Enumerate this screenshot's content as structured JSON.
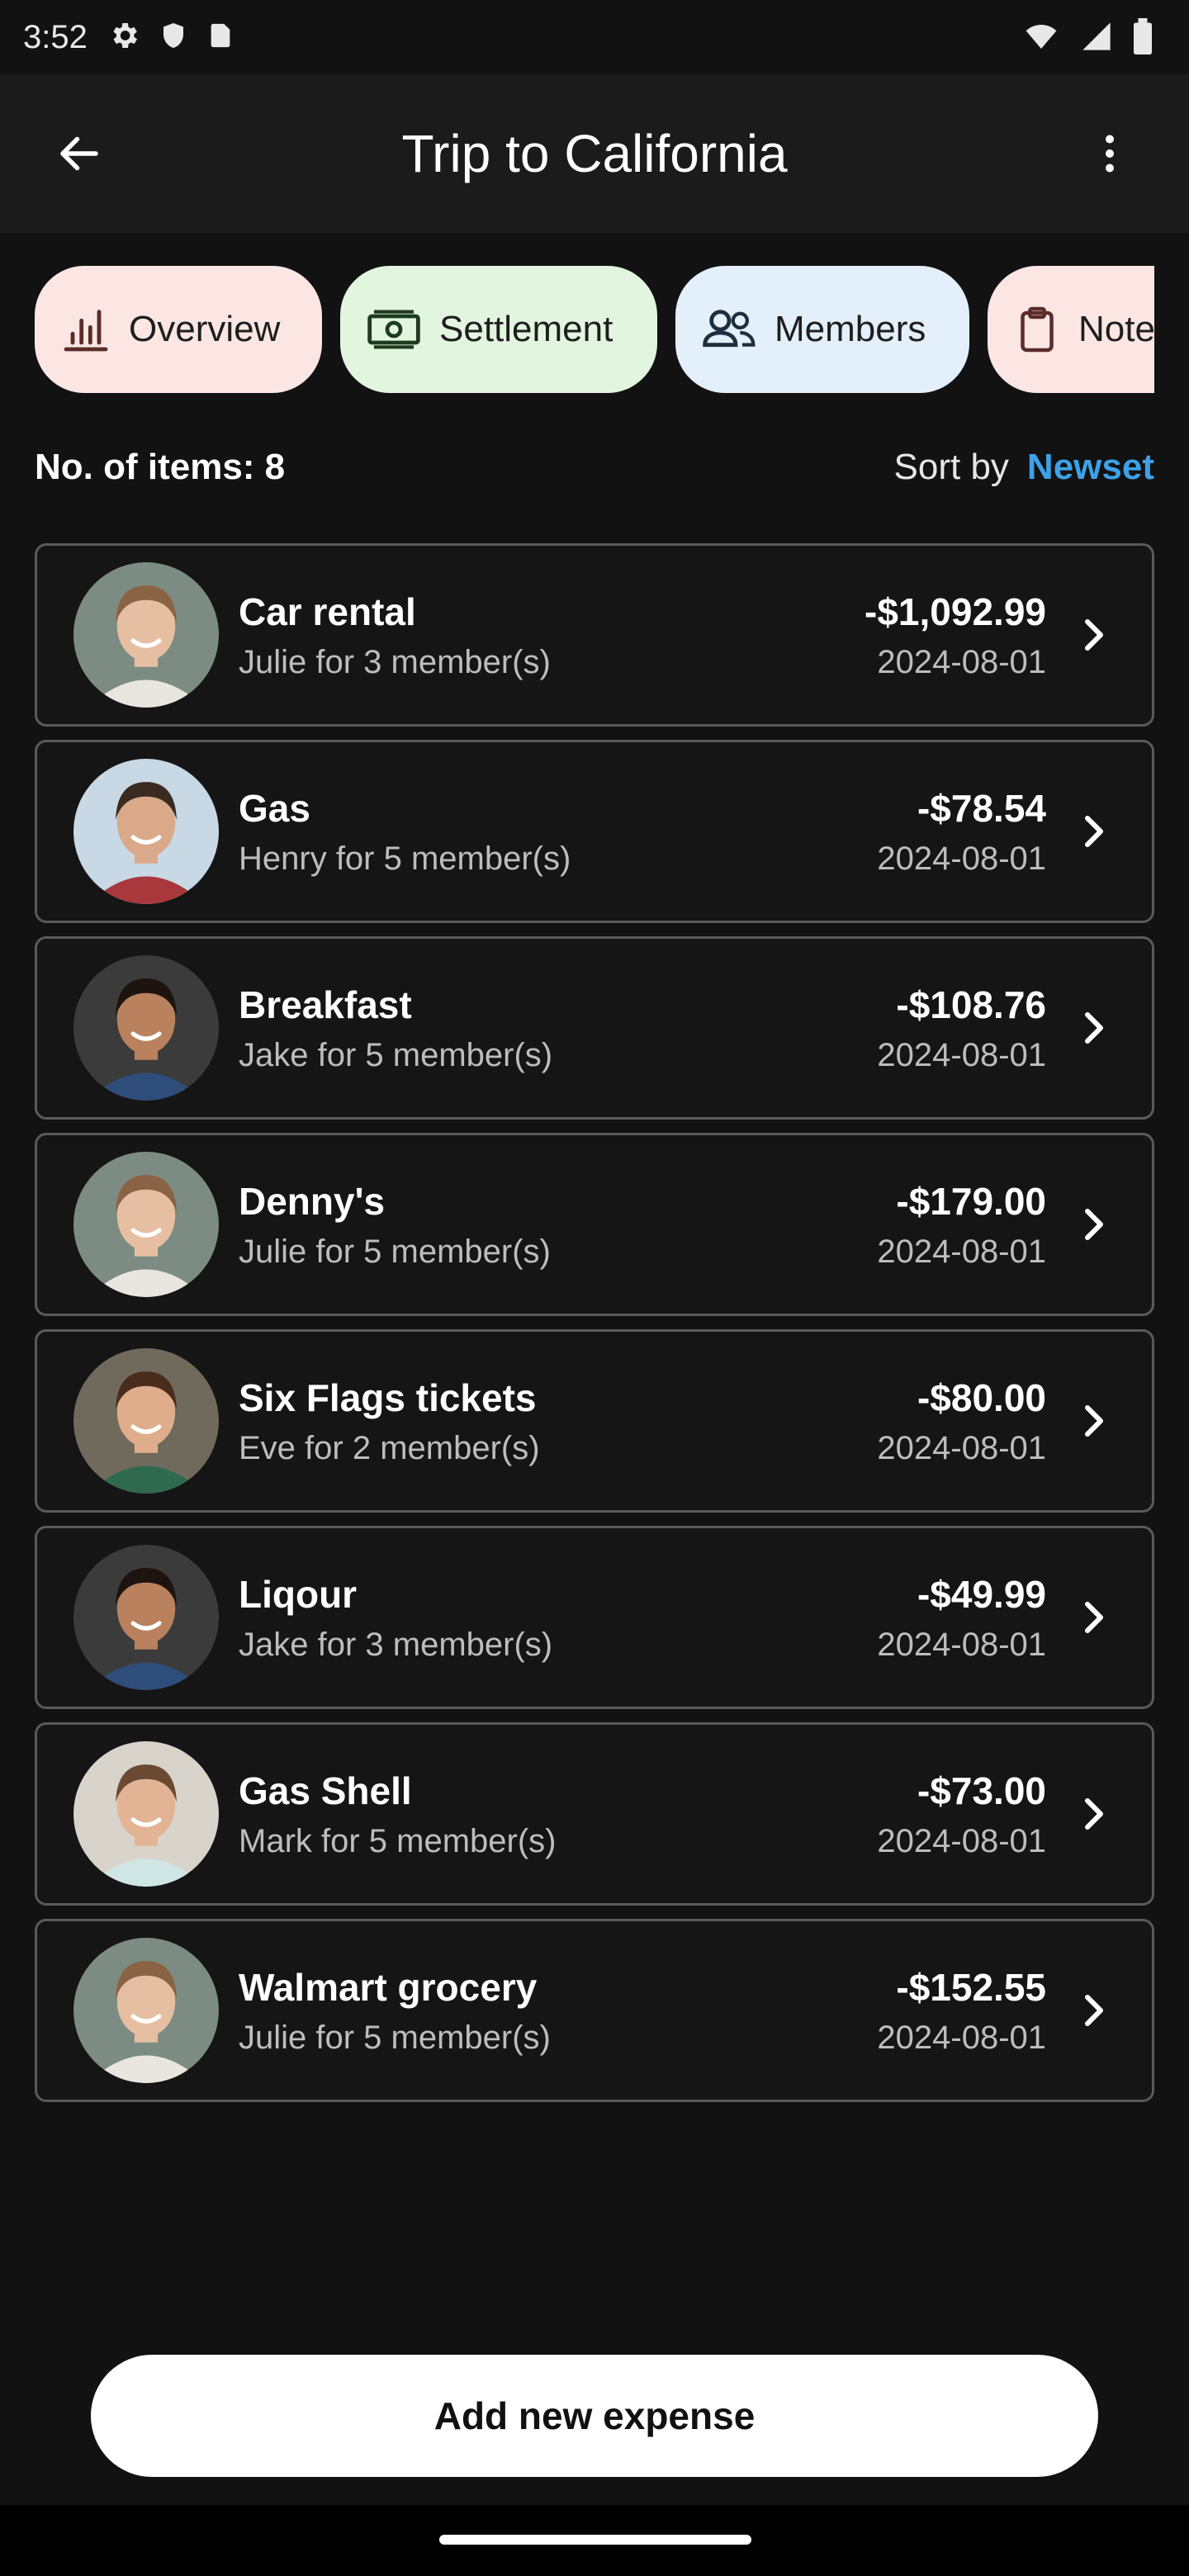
{
  "status_bar": {
    "time": "3:52",
    "icons": [
      "gear-icon",
      "shield-icon",
      "sim-card-icon"
    ],
    "right_icons": [
      "wifi-icon",
      "signal-icon",
      "battery-icon"
    ]
  },
  "app_bar": {
    "title": "Trip to California",
    "back_icon": "arrow-left-icon",
    "menu_icon": "more-vertical-icon"
  },
  "tabs": [
    {
      "label": "Overview",
      "icon": "bar-chart-icon",
      "color": "#fbe6e3"
    },
    {
      "label": "Settlement",
      "icon": "cash-icon",
      "color": "#e2f6df"
    },
    {
      "label": "Members",
      "icon": "people-icon",
      "color": "#e3f0fb"
    },
    {
      "label": "Notes",
      "icon": "clipboard-icon",
      "color": "#fbe6e3"
    }
  ],
  "list_header": {
    "count_label": "No. of items: 8",
    "sort_label": "Sort by",
    "sort_value": "Newset",
    "sort_color": "#3ea1e8"
  },
  "expenses": [
    {
      "title": "Car rental",
      "subtitle": "Julie for 3 member(s)",
      "amount": "-$1,092.99",
      "date": "2024-08-01",
      "avatar": "julie"
    },
    {
      "title": "Gas",
      "subtitle": "Henry for 5 member(s)",
      "amount": "-$78.54",
      "date": "2024-08-01",
      "avatar": "henry"
    },
    {
      "title": "Breakfast",
      "subtitle": "Jake for 5 member(s)",
      "amount": "-$108.76",
      "date": "2024-08-01",
      "avatar": "jake"
    },
    {
      "title": "Denny's",
      "subtitle": "Julie for 5 member(s)",
      "amount": "-$179.00",
      "date": "2024-08-01",
      "avatar": "julie"
    },
    {
      "title": "Six Flags tickets",
      "subtitle": "Eve for 2 member(s)",
      "amount": "-$80.00",
      "date": "2024-08-01",
      "avatar": "eve"
    },
    {
      "title": "Liqour",
      "subtitle": "Jake for 3 member(s)",
      "amount": "-$49.99",
      "date": "2024-08-01",
      "avatar": "jake"
    },
    {
      "title": "Gas Shell",
      "subtitle": "Mark for 5 member(s)",
      "amount": "-$73.00",
      "date": "2024-08-01",
      "avatar": "mark"
    },
    {
      "title": "Walmart grocery",
      "subtitle": "Julie for 5 member(s)",
      "amount": "-$152.55",
      "date": "2024-08-01",
      "avatar": "julie"
    }
  ],
  "add_button": {
    "label": "Add new expense"
  },
  "colors": {
    "background": "#121212",
    "app_bar": "#1b1b1b",
    "accent": "#3ea1e8"
  }
}
